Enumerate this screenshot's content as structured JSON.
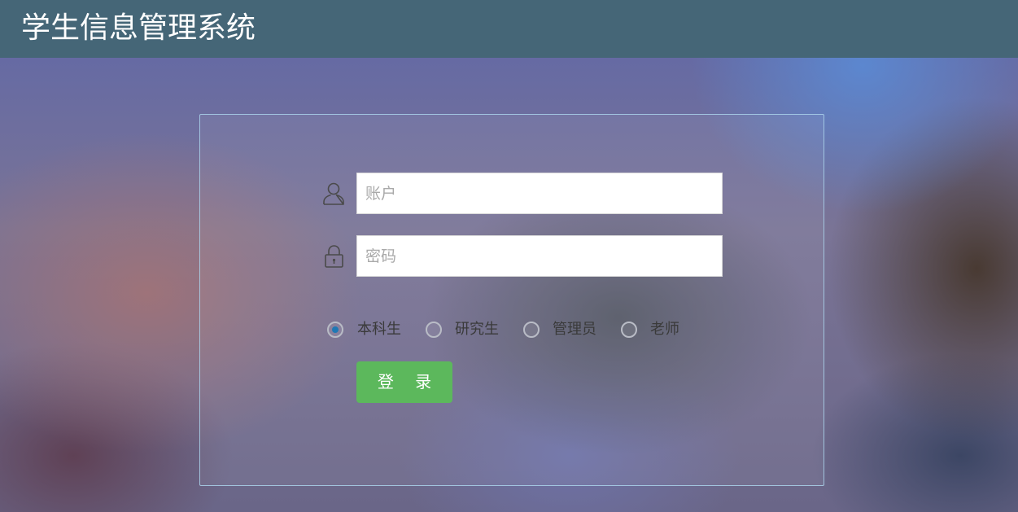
{
  "header": {
    "title": "学生信息管理系统"
  },
  "login_form": {
    "account_field": {
      "placeholder": "账户",
      "value": "",
      "icon": "user-icon"
    },
    "password_field": {
      "placeholder": "密码",
      "value": "",
      "icon": "lock-icon"
    },
    "roles": [
      {
        "label": "本科生",
        "checked": true
      },
      {
        "label": "研究生",
        "checked": false
      },
      {
        "label": "管理员",
        "checked": false
      },
      {
        "label": "老师",
        "checked": false
      }
    ],
    "login_button_label": "登 录"
  },
  "colors": {
    "header_bg": "#456677",
    "button_bg": "#5cb85c",
    "radio_selected": "#1f78b4"
  }
}
